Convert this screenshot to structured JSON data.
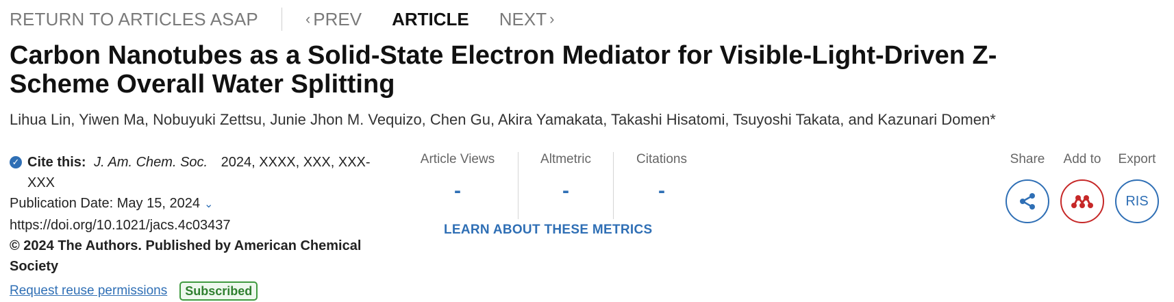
{
  "nav": {
    "return_label": "RETURN TO ARTICLES ASAP",
    "prev_label": "PREV",
    "current_label": "ARTICLE",
    "next_label": "NEXT"
  },
  "article": {
    "title": "Carbon Nanotubes as a Solid-State Electron Mediator for Visible-Light-Driven Z-Scheme Overall Water Splitting",
    "authors": "Lihua Lin, Yiwen Ma, Nobuyuki Zettsu, Junie Jhon M. Vequizo, Chen Gu, Akira Yamakata, Takashi Hisatomi, Tsuyoshi Takata, and Kazunari Domen*"
  },
  "meta": {
    "cite_label": "Cite this:",
    "journal": "J. Am. Chem. Soc.",
    "citation": "2024, XXXX, XXX, XXX-XXX",
    "pub_date": "Publication Date: May 15, 2024",
    "doi": "https://doi.org/10.1021/jacs.4c03437",
    "copyright": "© 2024 The Authors. Published by American Chemical Society",
    "reuse_link": "Request reuse permissions",
    "access_badge": "Subscribed"
  },
  "metrics": {
    "items": [
      {
        "label": "Article Views",
        "value": "-"
      },
      {
        "label": "Altmetric",
        "value": "-"
      },
      {
        "label": "Citations",
        "value": "-"
      }
    ],
    "learn_link": "LEARN ABOUT THESE METRICS"
  },
  "actions": {
    "share_label": "Share",
    "add_label": "Add to",
    "export_label": "Export",
    "export_button": "RIS"
  },
  "icons": {
    "share": "share-icon",
    "mendeley": "mendeley-icon",
    "check": "check-circle-icon",
    "chevron": "chevron-down-icon"
  },
  "colors": {
    "accent": "#2f6fb5",
    "mendeley": "#c62828",
    "badge": "#3f9a3f"
  }
}
